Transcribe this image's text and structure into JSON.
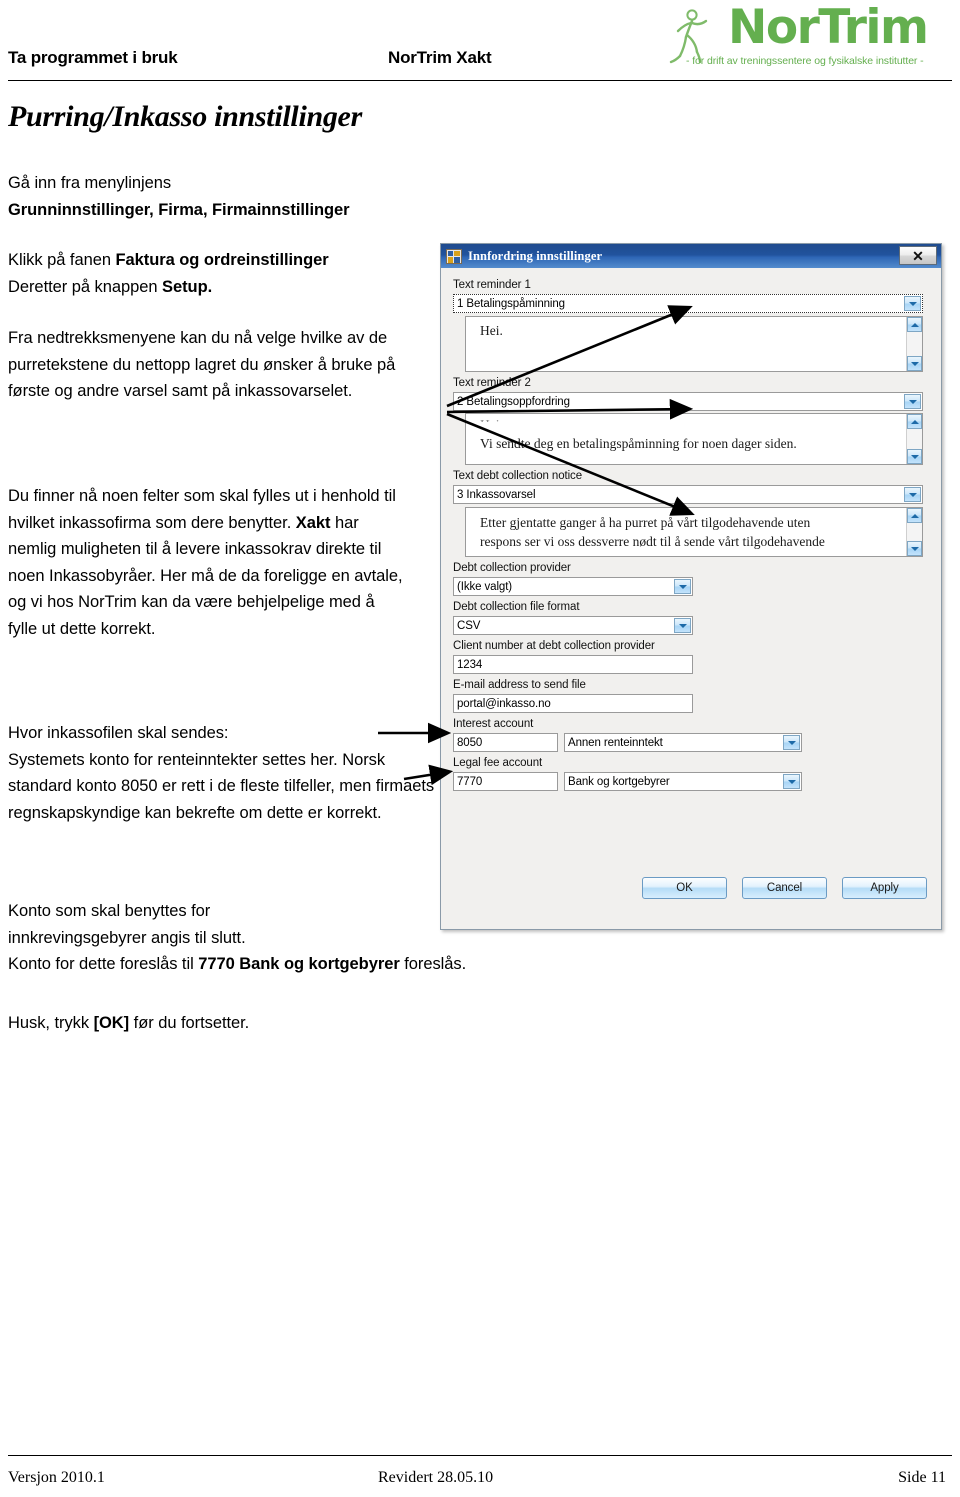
{
  "header": {
    "left_title": "Ta programmet i bruk",
    "center_title": "NorTrim Xakt",
    "logo_word": "NorTrim",
    "logo_tagline": "- for drift av treningssentere og fysikalske institutter -",
    "logo_color": "#64af4f"
  },
  "document": {
    "title": "Purring/Inkasso innstillinger",
    "paragraphs": {
      "p1_line1": "Gå inn fra menylinjens",
      "p1_line2": "Grunninnstillinger, Firma, Firmainnstillinger",
      "p2_line1_pre": "Klikk på fanen ",
      "p2_line1_bold": "Faktura og ordreinstillinger",
      "p2_line2_pre": "Deretter på knappen ",
      "p2_line2_bold": "Setup.",
      "p3": "Fra nedtrekksmenyene kan du nå velge hvilke av de purretekstene du nettopp lagret du ønsker å bruke på første og andre varsel samt på inkassovarselet.",
      "p4_a": "Du finner nå noen felter som skal fylles ut i henhold til hvilket inkassofirma som dere benytter.  ",
      "p4_bold": "Xakt",
      "p4_b": " har nemlig muligheten til å levere inkassokrav direkte til noen Inkassobyråer.  Her må de da foreligge en avtale, og vi hos NorTrim kan da være behjelpelige med å fylle ut dette korrekt.",
      "p5_line1": "Hvor inkassofilen skal sendes:",
      "p5_rest": "Systemets konto for renteinntekter settes her. Norsk standard konto 8050 er rett i de fleste tilfeller, men firmaets regnskapskyndige kan bekrefte om dette er korrekt.",
      "p6_line1": "Konto som skal benyttes for",
      "p6_line2": "innkrevingsgebyrer angis til slutt.",
      "p6_line3_pre": "Konto for dette foreslås til  ",
      "p6_line3_bold": "7770 Bank og kortgebyrer",
      "p6_line3_post": " foreslås.",
      "p7_pre": "Husk, trykk ",
      "p7_bold": "[OK]",
      "p7_post": " før du fortsetter."
    }
  },
  "dialog": {
    "title": "Innfordring innstillinger",
    "close_label": "✕",
    "fields": {
      "text_reminder_1_label": "Text reminder 1",
      "text_reminder_1_value": "1 Betalingspåminning",
      "text_reminder_1_body": "Hei.",
      "text_reminder_2_label": "Text reminder 2",
      "text_reminder_2_value": "2 Betalingsoppfordring",
      "text_reminder_2_body_clipped": "Hei.",
      "text_reminder_2_body": "Vi sendte deg en betalingspåminning for noen dager siden.",
      "debt_notice_label": "Text debt collection notice",
      "debt_notice_value": "3 Inkassovarsel",
      "debt_notice_body_line1": "Etter gjentatte ganger å ha purret på vårt tilgodehavende uten",
      "debt_notice_body_line2": "respons ser vi oss dessverre nødt til å sende vårt tilgodehavende",
      "provider_label": "Debt collection provider",
      "provider_value": "(Ikke valgt)",
      "file_format_label": "Debt collection file format",
      "file_format_value": "CSV",
      "client_number_label": "Client number at debt collection provider",
      "client_number_value": "1234",
      "email_label": "E-mail address to send file",
      "email_value": "portal@inkasso.no",
      "interest_account_label": "Interest account",
      "interest_account_number": "8050",
      "interest_account_name": "Annen renteinntekt",
      "legal_fee_label": "Legal fee account",
      "legal_fee_number": "7770",
      "legal_fee_name": "Bank og kortgebyrer"
    },
    "buttons": {
      "ok": "OK",
      "cancel": "Cancel",
      "apply": "Apply"
    }
  },
  "footer": {
    "version": "Versjon 2010.1",
    "revised": "Revidert 28.05.10",
    "page": "Side 11"
  }
}
